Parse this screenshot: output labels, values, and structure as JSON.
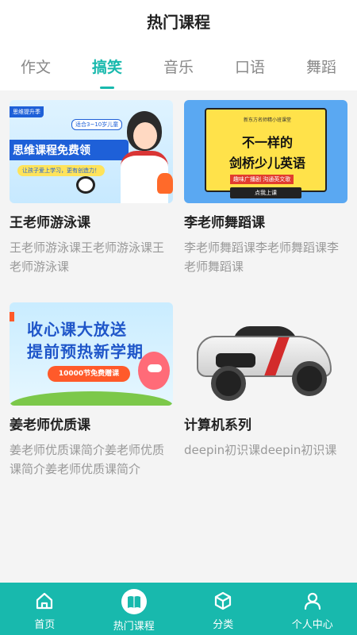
{
  "header": {
    "title": "热门课程"
  },
  "tabs": [
    {
      "label": "作文",
      "active": false
    },
    {
      "label": "搞笑",
      "active": true
    },
    {
      "label": "音乐",
      "active": false
    },
    {
      "label": "口语",
      "active": false
    },
    {
      "label": "舞蹈",
      "active": false
    }
  ],
  "courses": [
    {
      "title": "王老师游泳课",
      "desc": "王老师游泳课王老师游泳课王老师游泳课",
      "thumb": {
        "tag": "思维提升季",
        "headline": "思维课程免费领",
        "age": "适合3~10岁儿童",
        "sub": "让孩子爱上学习，更有创造力！"
      }
    },
    {
      "title": "李老师舞蹈课",
      "desc": "李老师舞蹈课李老师舞蹈课李老师舞蹈课",
      "thumb": {
        "small": "新东方名师精小班课堂",
        "line1": "不一样的",
        "line2": "剑桥少儿英语",
        "red": "趣味广播剧 沟通英文歌",
        "cta": "点我上课"
      }
    },
    {
      "title": "姜老师优质课",
      "desc": "姜老师优质课简介姜老师优质课简介姜老师优质课简介",
      "thumb": {
        "line1": "收心课大放送",
        "line2": "提前预热新学期",
        "pill": "10000节免费赠课"
      }
    },
    {
      "title": "计算机系列",
      "desc": "deepin初识课deepin初识课",
      "thumb": {}
    }
  ],
  "bottom_nav": [
    {
      "label": "首页",
      "icon": "home-icon",
      "active": false
    },
    {
      "label": "热门课程",
      "icon": "book-icon",
      "active": true
    },
    {
      "label": "分类",
      "icon": "cube-icon",
      "active": false
    },
    {
      "label": "个人中心",
      "icon": "user-icon",
      "active": false
    }
  ],
  "colors": {
    "accent": "#18b9ad",
    "tab_inactive": "#888888",
    "content_bg": "#f4f4f4"
  }
}
